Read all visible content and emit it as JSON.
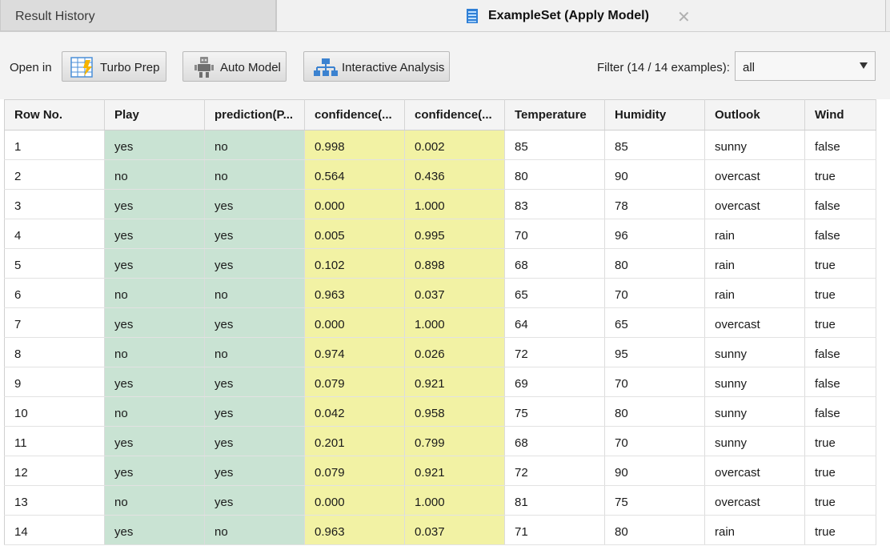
{
  "tabs": {
    "history_label": "Result History",
    "active_label": "ExampleSet (Apply Model)",
    "close_glyph": "✕"
  },
  "toolbar": {
    "open_in_label": "Open in",
    "turbo_prep_label": "Turbo Prep",
    "auto_model_label": "Auto Model",
    "interactive_analysis_label": "Interactive Analysis",
    "filter_label": "Filter (14 / 14 examples):",
    "filter_value": "all"
  },
  "colors": {
    "label_column": "#c9e3d3",
    "confidence_column": "#f2f2a4"
  },
  "table": {
    "columns": [
      "Row No.",
      "Play",
      "prediction(P...",
      "confidence(...",
      "confidence(...",
      "Temperature",
      "Humidity",
      "Outlook",
      "Wind"
    ],
    "rows": [
      [
        "1",
        "yes",
        "no",
        "0.998",
        "0.002",
        "85",
        "85",
        "sunny",
        "false"
      ],
      [
        "2",
        "no",
        "no",
        "0.564",
        "0.436",
        "80",
        "90",
        "overcast",
        "true"
      ],
      [
        "3",
        "yes",
        "yes",
        "0.000",
        "1.000",
        "83",
        "78",
        "overcast",
        "false"
      ],
      [
        "4",
        "yes",
        "yes",
        "0.005",
        "0.995",
        "70",
        "96",
        "rain",
        "false"
      ],
      [
        "5",
        "yes",
        "yes",
        "0.102",
        "0.898",
        "68",
        "80",
        "rain",
        "true"
      ],
      [
        "6",
        "no",
        "no",
        "0.963",
        "0.037",
        "65",
        "70",
        "rain",
        "true"
      ],
      [
        "7",
        "yes",
        "yes",
        "0.000",
        "1.000",
        "64",
        "65",
        "overcast",
        "true"
      ],
      [
        "8",
        "no",
        "no",
        "0.974",
        "0.026",
        "72",
        "95",
        "sunny",
        "false"
      ],
      [
        "9",
        "yes",
        "yes",
        "0.079",
        "0.921",
        "69",
        "70",
        "sunny",
        "false"
      ],
      [
        "10",
        "no",
        "yes",
        "0.042",
        "0.958",
        "75",
        "80",
        "sunny",
        "false"
      ],
      [
        "11",
        "yes",
        "yes",
        "0.201",
        "0.799",
        "68",
        "70",
        "sunny",
        "true"
      ],
      [
        "12",
        "yes",
        "yes",
        "0.079",
        "0.921",
        "72",
        "90",
        "overcast",
        "true"
      ],
      [
        "13",
        "no",
        "yes",
        "0.000",
        "1.000",
        "81",
        "75",
        "overcast",
        "true"
      ],
      [
        "14",
        "yes",
        "no",
        "0.963",
        "0.037",
        "71",
        "80",
        "rain",
        "true"
      ]
    ]
  }
}
